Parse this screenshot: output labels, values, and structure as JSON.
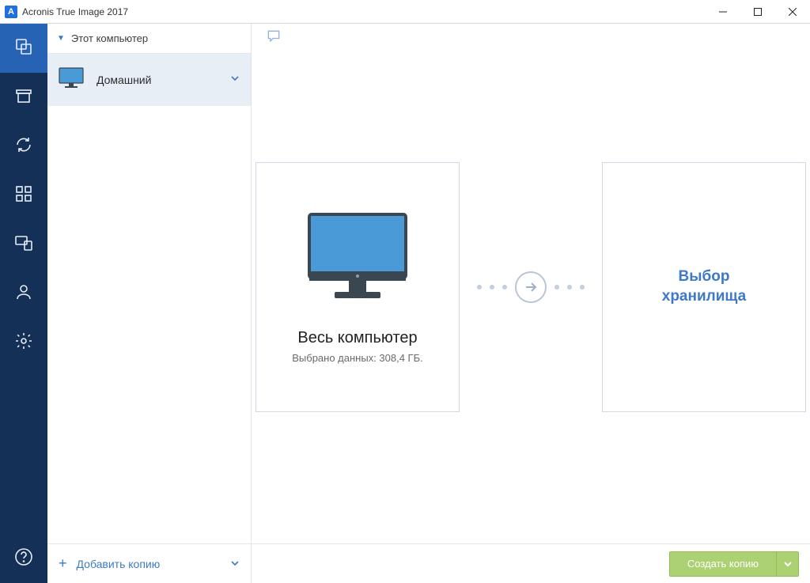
{
  "window": {
    "title": "Acronis True Image 2017",
    "app_letter": "A"
  },
  "sidebar": {
    "header": "Этот компьютер",
    "backup": {
      "name": "Домашний"
    },
    "add_label": "Добавить копию"
  },
  "main": {
    "source": {
      "title": "Весь компьютер",
      "subtitle": "Выбрано данных: 308,4 ГБ."
    },
    "target": {
      "line1": "Выбор",
      "line2": "хранилища"
    },
    "create_button": "Создать копию"
  }
}
